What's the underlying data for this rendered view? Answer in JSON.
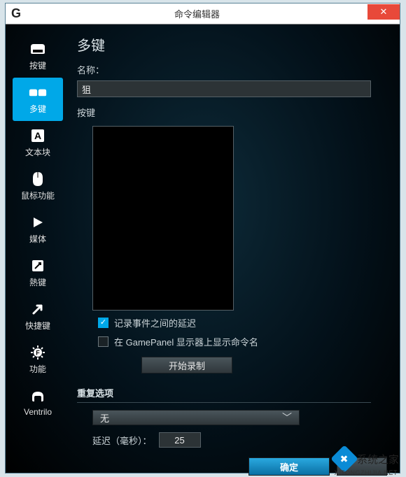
{
  "window": {
    "title": "命令编辑器",
    "logo_letter": "G"
  },
  "sidebar": {
    "items": [
      {
        "label": "按键",
        "icon": "key-icon"
      },
      {
        "label": "多键",
        "icon": "multikey-icon",
        "active": true
      },
      {
        "label": "文本块",
        "icon": "textblock-icon"
      },
      {
        "label": "鼠标功能",
        "icon": "mouse-icon"
      },
      {
        "label": "媒体",
        "icon": "media-icon"
      },
      {
        "label": "熱键",
        "icon": "hotkey-icon"
      },
      {
        "label": "快捷键",
        "icon": "shortcut-icon"
      },
      {
        "label": "功能",
        "icon": "function-icon"
      },
      {
        "label": "Ventrilo",
        "icon": "ventrilo-icon"
      }
    ]
  },
  "main": {
    "heading": "多键",
    "name_label": "名称：",
    "name_value": "狙",
    "keys_label": "按键",
    "record_delay_label": "记录事件之间的延迟",
    "record_delay_checked": true,
    "gamepanel_label": "在 GamePanel 显示器上显示命令名",
    "gamepanel_checked": false,
    "start_record_label": "开始录制",
    "repeat_section": "重复选项",
    "repeat_value": "无",
    "delay_label": "延迟（毫秒）：",
    "delay_value": "25"
  },
  "footer": {
    "ok": "确定",
    "cancel": ""
  },
  "watermark": {
    "text": "系统之家",
    "sub": "XITONGZHIJIA.NET"
  }
}
